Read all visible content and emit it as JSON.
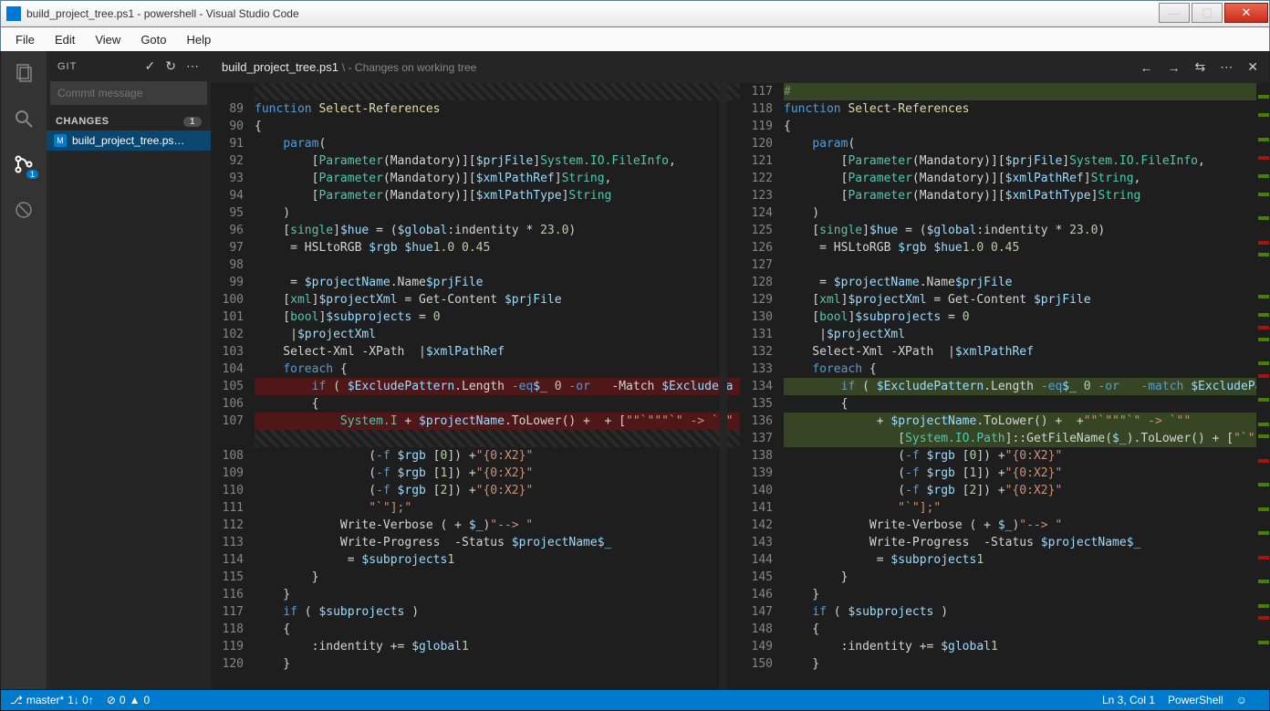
{
  "window": {
    "title": "build_project_tree.ps1 - powershell - Visual Studio Code"
  },
  "menu": [
    "File",
    "Edit",
    "View",
    "Goto",
    "Help"
  ],
  "activitybar": {
    "git_badge": "1"
  },
  "sidebar": {
    "title": "GIT",
    "commit_placeholder": "Commit message",
    "changes_label": "CHANGES",
    "changes_count": "1",
    "file_badge": "M",
    "file_name": "build_project_tree.ps…"
  },
  "tab": {
    "name": "build_project_tree.ps1",
    "desc": "\\ - Changes on working tree"
  },
  "left_start": 89,
  "right_start": 117,
  "code_left": [
    {
      "t": "kw",
      "s": "function ",
      "r": "Select-References",
      "k": "fn"
    },
    {
      "raw": "{"
    },
    {
      "raw": "    ",
      "t": "kw",
      "s": "param",
      "r": "("
    },
    {
      "raw": "        [",
      "t": "type",
      "s": "Parameter",
      "r": "(Mandatory)][",
      "t2": "type",
      "s2": "System.IO.FileInfo",
      "r2": "]",
      "v": "$prjFile",
      "r3": ","
    },
    {
      "raw": "        [",
      "t": "type",
      "s": "Parameter",
      "r": "(Mandatory)][",
      "t2": "type",
      "s2": "String",
      "r2": "]",
      "v": "$xmlPathRef",
      "r3": ","
    },
    {
      "raw": "        [",
      "t": "type",
      "s": "Parameter",
      "r": "(Mandatory)][",
      "t2": "type",
      "s2": "String",
      "r2": "]",
      "v": "$xmlPathType"
    },
    {
      "raw": "    )"
    },
    {
      "raw": "    [",
      "t": "type",
      "s": "single",
      "r": "]",
      "v": "$hue",
      "r2": " = (",
      "v2": "$global",
      "r3": ":indentity * ",
      "n": "23.0",
      "r4": ")"
    },
    {
      "raw": "    ",
      "v": "$rgb",
      "r": " = HSLtoRGB ",
      "v2": "$hue",
      "r2": " ",
      "n": "1.0 0.45"
    },
    {
      "raw": ""
    },
    {
      "raw": "    ",
      "v": "$projectName",
      "r": " = ",
      "v2": "$prjFile",
      "r2": ".Name"
    },
    {
      "raw": "    [",
      "t": "type",
      "s": "xml",
      "r": "]",
      "v": "$projectXml",
      "r2": " = Get-Content ",
      "v2": "$prjFile"
    },
    {
      "raw": "    [",
      "t": "type",
      "s": "bool",
      "r": "]",
      "v": "$subprojects",
      "r2": " = ",
      "n": "0"
    },
    {
      "raw": "    ",
      "v": "$projectXml",
      "r": " |"
    },
    {
      "raw": "    Select-Xml -XPath ",
      "v": "$xmlPathRef",
      "r": " |"
    },
    {
      "raw": "    ",
      "t": "kw",
      "s": "foreach",
      "r": " {"
    },
    {
      "cls": "removed",
      "raw": "        ",
      "t": "kw",
      "s": "if",
      "r": " ( ",
      "v": "$ExcludePattern",
      "r2": ".Length ",
      "t2": "kw",
      "s2": "-eq",
      "r3": " ",
      "n": "0",
      "r4": " ",
      "t3": "kw",
      "s3": "-or",
      "r5": " ",
      "v2": "$_",
      "r6": "  -Match ",
      "v3": "$ExcludePa"
    },
    {
      "raw": "        {"
    },
    {
      "cls": "removed",
      "raw": "            ",
      "str": "\"\"`\"\"",
      "r": " + ",
      "v": "$projectName",
      "r2": ".ToLower() + ",
      "str2": "\"`\" -> `\"\"",
      "r3": " + [",
      "t": "type",
      "s": "System.I"
    },
    {
      "cls": "hatch",
      "raw": " "
    },
    {
      "raw": "                (",
      "str": "\"{0:X2}\"",
      "r": " ",
      "t": "kw",
      "s": "-f",
      "r2": " ",
      "v": "$rgb",
      "r3": "[",
      "n": "0",
      "r4": "]) +"
    },
    {
      "raw": "                (",
      "str": "\"{0:X2}\"",
      "r": " ",
      "t": "kw",
      "s": "-f",
      "r2": " ",
      "v": "$rgb",
      "r3": "[",
      "n": "1",
      "r4": "]) +"
    },
    {
      "raw": "                (",
      "str": "\"{0:X2}\"",
      "r": " ",
      "t": "kw",
      "s": "-f",
      "r2": " ",
      "v": "$rgb",
      "r3": "[",
      "n": "2",
      "r4": "]) +"
    },
    {
      "raw": "                ",
      "str": "\"`\"];\""
    },
    {
      "raw": "            Write-Verbose (",
      "str": "\"--> \"",
      "r": " + ",
      "v": "$_",
      "r2": ")"
    },
    {
      "raw": "            Write-Progress ",
      "v": "$projectName",
      "r": " -Status ",
      "v2": "$_"
    },
    {
      "raw": "            ",
      "v": "$subprojects",
      "r": " = ",
      "n": "1"
    },
    {
      "raw": "        }"
    },
    {
      "raw": "    }"
    },
    {
      "raw": "    ",
      "t": "kw",
      "s": "if",
      "r": " ( ",
      "v": "$subprojects",
      "r2": " )"
    },
    {
      "raw": "    {"
    },
    {
      "raw": "        ",
      "v": "$global",
      "r": ":indentity += ",
      "n": "1"
    },
    {
      "raw": "    }"
    }
  ],
  "code_right": [
    {
      "cls": "added",
      "t": "cmt",
      "s": "#"
    },
    {
      "t": "kw",
      "s": "function ",
      "r": "Select-References",
      "k": "fn"
    },
    {
      "raw": "{"
    },
    {
      "raw": "    ",
      "t": "kw",
      "s": "param",
      "r": "("
    },
    {
      "raw": "        [",
      "t": "type",
      "s": "Parameter",
      "r": "(Mandatory)][",
      "t2": "type",
      "s2": "System.IO.FileInfo",
      "r2": "]",
      "v": "$prjFile",
      "r3": ","
    },
    {
      "raw": "        [",
      "t": "type",
      "s": "Parameter",
      "r": "(Mandatory)][",
      "t2": "type",
      "s2": "String",
      "r2": "]",
      "v": "$xmlPathRef",
      "r3": ","
    },
    {
      "raw": "        [",
      "t": "type",
      "s": "Parameter",
      "r": "(Mandatory)][",
      "t2": "type",
      "s2": "String",
      "r2": "]",
      "v": "$xmlPathType"
    },
    {
      "raw": "    )"
    },
    {
      "raw": "    [",
      "t": "type",
      "s": "single",
      "r": "]",
      "v": "$hue",
      "r2": " = (",
      "v2": "$global",
      "r3": ":indentity * ",
      "n": "23.0",
      "r4": ")"
    },
    {
      "raw": "    ",
      "v": "$rgb",
      "r": " = HSLtoRGB ",
      "v2": "$hue",
      "r2": " ",
      "n": "1.0 0.45"
    },
    {
      "raw": ""
    },
    {
      "raw": "    ",
      "v": "$projectName",
      "r": " = ",
      "v2": "$prjFile",
      "r2": ".Name"
    },
    {
      "raw": "    [",
      "t": "type",
      "s": "xml",
      "r": "]",
      "v": "$projectXml",
      "r2": " = Get-Content ",
      "v2": "$prjFile"
    },
    {
      "raw": "    [",
      "t": "type",
      "s": "bool",
      "r": "]",
      "v": "$subprojects",
      "r2": " = ",
      "n": "0"
    },
    {
      "raw": "    ",
      "v": "$projectXml",
      "r": " |"
    },
    {
      "raw": "    Select-Xml -XPath ",
      "v": "$xmlPathRef",
      "r": " |"
    },
    {
      "raw": "    ",
      "t": "kw",
      "s": "foreach",
      "r": " {"
    },
    {
      "cls": "added",
      "raw": "        ",
      "t": "kw",
      "s": "if",
      "r": " ( ",
      "v": "$ExcludePattern",
      "r2": ".Length ",
      "t2": "kw",
      "s2": "-eq",
      "r3": " ",
      "n": "0",
      "r4": " ",
      "t3": "kw",
      "s3": "-or",
      "r5": " ",
      "v2": "$_",
      "r6": "  ",
      "t4": "kw",
      "s4": "-match",
      "r7": " ",
      "v3": "$ExcludePa"
    },
    {
      "raw": "        {"
    },
    {
      "cls": "added",
      "raw": "            ",
      "str": "\"\"`\"\"",
      "r": " + ",
      "v": "$projectName",
      "r2": ".ToLower() + ",
      "str2": "\"`\" -> `\"\"",
      "r3": " +"
    },
    {
      "cls": "added",
      "raw": "                [",
      "t": "type",
      "s": "System.IO.Path",
      "r": "]::GetFileName(",
      "v": "$_",
      "r2": ").ToLower() +",
      "str": "\"`\"",
      "r3": " ["
    },
    {
      "raw": "                (",
      "str": "\"{0:X2}\"",
      "r": " ",
      "t": "kw",
      "s": "-f",
      "r2": " ",
      "v": "$rgb",
      "r3": "[",
      "n": "0",
      "r4": "]) +"
    },
    {
      "raw": "                (",
      "str": "\"{0:X2}\"",
      "r": " ",
      "t": "kw",
      "s": "-f",
      "r2": " ",
      "v": "$rgb",
      "r3": "[",
      "n": "1",
      "r4": "]) +"
    },
    {
      "raw": "                (",
      "str": "\"{0:X2}\"",
      "r": " ",
      "t": "kw",
      "s": "-f",
      "r2": " ",
      "v": "$rgb",
      "r3": "[",
      "n": "2",
      "r4": "]) +"
    },
    {
      "raw": "                ",
      "str": "\"`\"];\""
    },
    {
      "raw": "            Write-Verbose (",
      "str": "\"--> \"",
      "r": " + ",
      "v": "$_",
      "r2": ")"
    },
    {
      "raw": "            Write-Progress ",
      "v": "$projectName",
      "r": " -Status ",
      "v2": "$_"
    },
    {
      "raw": "            ",
      "v": "$subprojects",
      "r": " = ",
      "n": "1"
    },
    {
      "raw": "        }"
    },
    {
      "raw": "    }"
    },
    {
      "raw": "    ",
      "t": "kw",
      "s": "if",
      "r": " ( ",
      "v": "$subprojects",
      "r2": " )"
    },
    {
      "raw": "    {"
    },
    {
      "raw": "        ",
      "v": "$global",
      "r": ":indentity += ",
      "n": "1"
    },
    {
      "raw": "    }"
    }
  ],
  "status": {
    "branch_icon": "⎇",
    "branch": "master*",
    "sync": "1↓ 0↑",
    "err_icon": "⊘",
    "errors": "0",
    "warn_icon": "▲",
    "warnings": "0",
    "pos": "Ln 3, Col 1",
    "lang": "PowerShell",
    "smile": "☺"
  }
}
